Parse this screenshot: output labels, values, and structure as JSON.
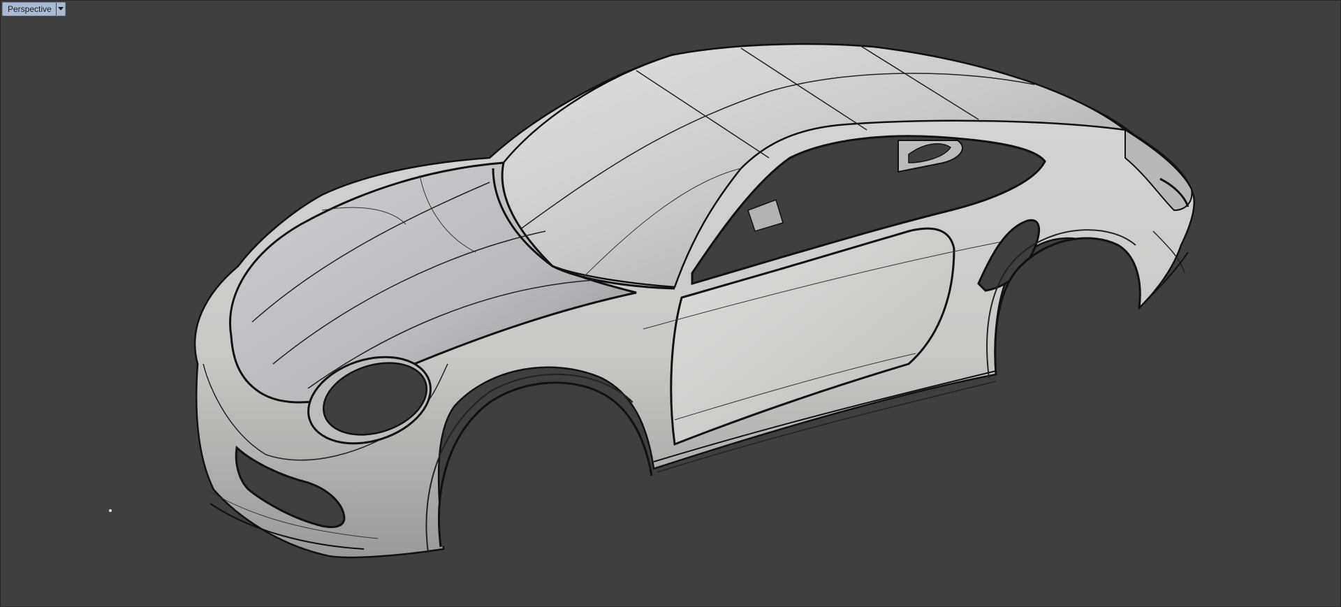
{
  "viewport": {
    "title": "Perspective",
    "menu_icon": "chevron-down-icon",
    "background_color": "#3f3f3f",
    "tab_color": "#a9bbd3"
  },
  "model": {
    "subject": "car-body-surface-model",
    "surface_color": "#c9c9c9",
    "edge_color": "#111111"
  }
}
